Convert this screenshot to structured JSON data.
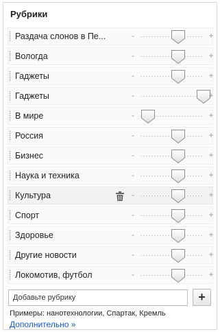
{
  "title": "Рубрики",
  "items": [
    {
      "label": "Раздача слонов в Пе...",
      "level": 0.6,
      "minus": "-",
      "plus": "+"
    },
    {
      "label": "Вологда",
      "level": 0.6,
      "minus": "-",
      "plus": "+"
    },
    {
      "label": "Гаджеты",
      "level": 0.6,
      "minus": "-",
      "plus": "+"
    },
    {
      "label": "Гаджеты",
      "level": 1.0,
      "minus": "-",
      "plus": "+"
    },
    {
      "label": "В мире",
      "level": 0.12,
      "minus": "-",
      "plus": "+"
    },
    {
      "label": "Россия",
      "level": 0.6,
      "minus": "-",
      "plus": "+"
    },
    {
      "label": "Бизнес",
      "level": 0.6,
      "minus": "-",
      "plus": "+"
    },
    {
      "label": "Наука и техника",
      "level": 0.6,
      "minus": "-",
      "plus": "+"
    },
    {
      "label": "Культура",
      "level": 0.6,
      "minus": "-",
      "plus": "+",
      "hover": true,
      "icon": "trash-icon"
    },
    {
      "label": "Спорт",
      "level": 0.6,
      "minus": "-",
      "plus": "+"
    },
    {
      "label": "Здоровье",
      "level": 0.6,
      "minus": "-",
      "plus": "+"
    },
    {
      "label": "Другие новости",
      "level": 0.6,
      "minus": "-",
      "plus": "+"
    },
    {
      "label": "Локомотив, футбол",
      "level": 0.6,
      "minus": "-",
      "plus": "+"
    }
  ],
  "add": {
    "placeholder": "Добавьте рубрику",
    "button_label": "+"
  },
  "examples": "Примеры: нанотехнологии, Спартак, Кремль",
  "more_link": "Дополнительно »",
  "colors": {
    "link": "#1155cc",
    "border": "#d6d6d6"
  }
}
